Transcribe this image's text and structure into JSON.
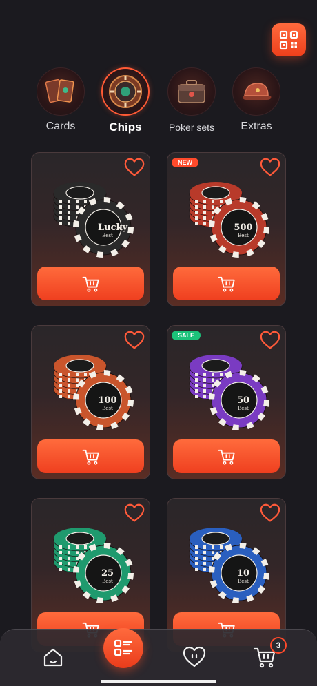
{
  "header": {
    "qr_icon": "qr-code-icon"
  },
  "categories": [
    {
      "label": "Cards",
      "icon": "cards-icon",
      "active": false
    },
    {
      "label": "Chips",
      "icon": "chips-icon",
      "active": true
    },
    {
      "label": "Poker sets",
      "icon": "poker-case-icon",
      "active": false
    },
    {
      "label": "Extras",
      "icon": "cap-icon",
      "active": false
    }
  ],
  "products": [
    {
      "badge": "",
      "chip_text": "Lucky",
      "chip_sub": "Best",
      "chip_color": "#2a2a2a",
      "accent": "#b84a38"
    },
    {
      "badge": "NEW",
      "badge_color": "#ff4a2b",
      "chip_text": "500",
      "chip_sub": "Best",
      "chip_color": "#b83a2a",
      "accent": "#b83a2a"
    },
    {
      "badge": "",
      "chip_text": "100",
      "chip_sub": "Best",
      "chip_color": "#c9552c",
      "accent": "#c9552c"
    },
    {
      "badge": "SALE",
      "badge_color": "#1cc27a",
      "chip_text": "50",
      "chip_sub": "Best",
      "chip_color": "#7a3bc2",
      "accent": "#7a3bc2"
    },
    {
      "badge": "",
      "chip_text": "25",
      "chip_sub": "Best",
      "chip_color": "#1f9a6e",
      "accent": "#1f9a6e"
    },
    {
      "badge": "",
      "chip_text": "10",
      "chip_sub": "Best",
      "chip_color": "#2a5fbf",
      "accent": "#2a5fbf"
    }
  ],
  "tabbar": {
    "items": [
      "home-icon",
      "catalog-icon",
      "favorites-icon",
      "cart-icon"
    ],
    "cart_count": "3"
  },
  "colors": {
    "accent": "#ff5a35",
    "background": "#1b1a1f"
  }
}
